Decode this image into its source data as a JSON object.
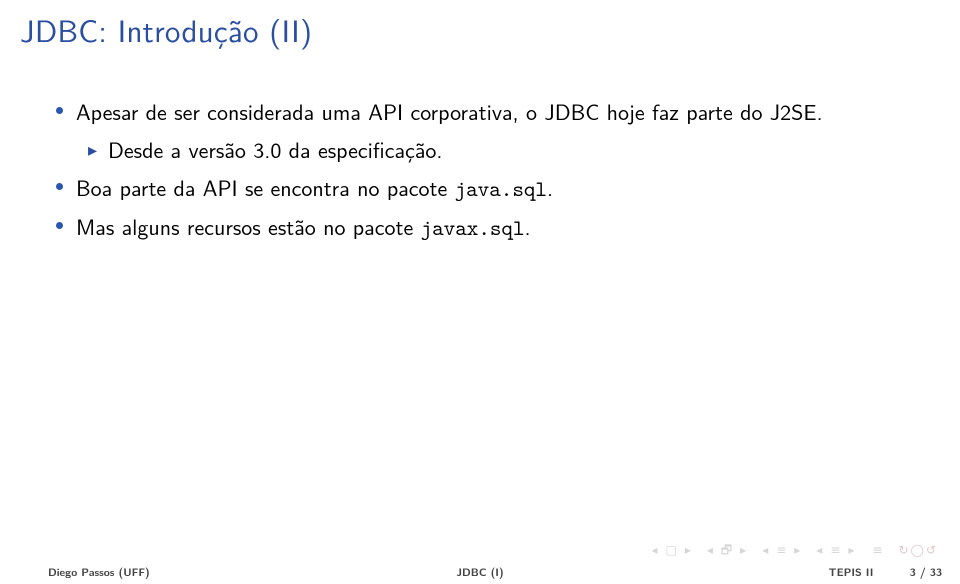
{
  "title": "JDBC: Introdução (II)",
  "bullets": {
    "b1": "Apesar de ser considerada uma API corporativa, o JDBC hoje faz parte do J2SE.",
    "b1_sub1": "Desde a versão 3.0 da especificação.",
    "b2_pre": "Boa parte da API se encontra no pacote ",
    "b2_code": "java.sql",
    "b2_post": ".",
    "b3_pre": "Mas alguns recursos estão no pacote ",
    "b3_code": "javax.sql",
    "b3_post": "."
  },
  "footer": {
    "author": "Diego Passos (UFF)",
    "title": "JDBC (I)",
    "course": "TEPIS II",
    "page": "3 / 33"
  }
}
